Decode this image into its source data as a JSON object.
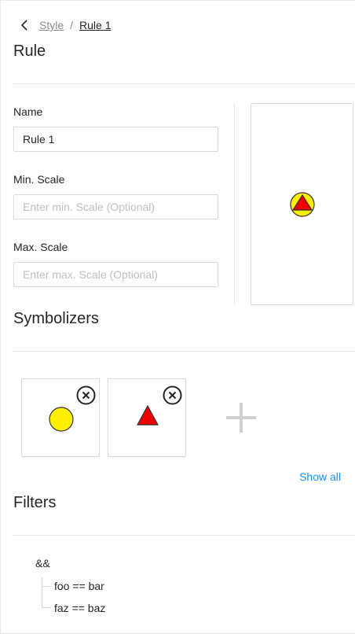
{
  "breadcrumb": {
    "parent": "Style",
    "separator": "/",
    "current": "Rule 1"
  },
  "page": {
    "title": "Rule"
  },
  "form": {
    "name_label": "Name",
    "name_value": "Rule 1",
    "min_scale_label": "Min. Scale",
    "min_scale_placeholder": "Enter min. Scale (Optional)",
    "max_scale_label": "Max. Scale",
    "max_scale_placeholder": "Enter max. Scale (Optional)"
  },
  "symbolizers": {
    "title": "Symbolizers",
    "items": [
      {
        "kind": "circle",
        "fill": "#ffee00",
        "stroke": "#333333"
      },
      {
        "kind": "triangle",
        "fill": "#ee0000",
        "stroke": "#333333"
      }
    ],
    "show_all_label": "Show all"
  },
  "filters": {
    "title": "Filters",
    "operator": "&&",
    "conditions": [
      "foo == bar",
      "faz == baz"
    ]
  },
  "colors": {
    "accent": "#1890ff",
    "border": "#d9d9d9",
    "circle_fill": "#ffee00",
    "triangle_fill": "#ee0000"
  }
}
